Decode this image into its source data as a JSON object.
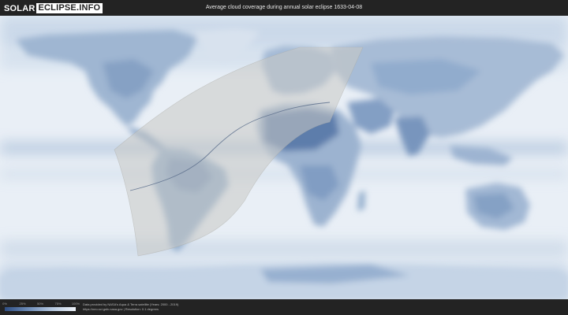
{
  "header": {
    "logo_part1": "SOLAR",
    "logo_part2": "ECLIPSE.INFO",
    "title": "Average cloud coverage during annual solar eclipse 1633-04-08"
  },
  "legend": {
    "ticks": [
      "0%",
      "25%",
      "50%",
      "75%",
      "100%"
    ],
    "colors": [
      "#2f4e82",
      "#6e8db8",
      "#b6c9e0",
      "#eef3f9"
    ]
  },
  "footer": {
    "credit_line1": "Data provided by NASA's Aqua & Terra satellite (Years: 2000 - 2019)",
    "credit_line2": "https://neo.sci.gsfc.nasa.gov | Resolution: 0.1 degrees"
  },
  "map": {
    "ocean_color": "#e9eff6",
    "shadow_color": "#c9c9c4"
  }
}
